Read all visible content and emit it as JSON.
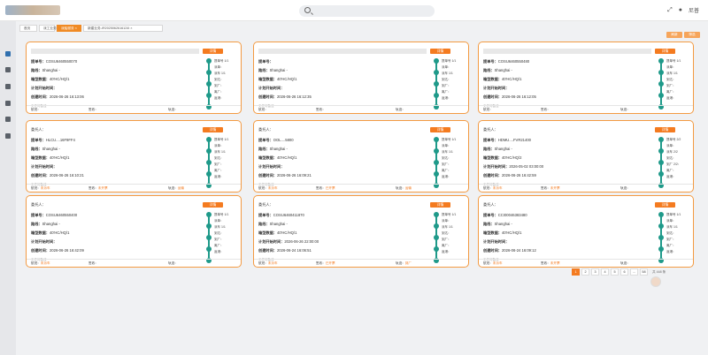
{
  "app": {
    "title": "",
    "user": "尼普"
  },
  "search": {
    "placeholder": ""
  },
  "tabs": [
    {
      "label": "首页",
      "active": false
    },
    {
      "label": "派工业务",
      "active": false
    },
    {
      "label": "派船服务 ×",
      "active": true
    },
    {
      "label": "新建业务-IR2025062616124I ×",
      "active": false
    }
  ],
  "toolbar": {
    "refresh": "刷新",
    "filter": "筛选"
  },
  "cards": [
    {
      "id": "c1",
      "top_text": "",
      "fields": [
        {
          "label": "提单号：",
          "value": "COSU6460550070"
        },
        {
          "label": "路线：",
          "value": "Shanghai -"
        },
        {
          "label": "箱型数据：",
          "value": "40'HC/HQ/1"
        },
        {
          "label": "计划开始时间：",
          "value": ""
        },
        {
          "label": "创建时间：",
          "value": "2026-06-26 16:13:06"
        }
      ],
      "note": "无任何备注",
      "footer": {
        "ship": "航班：",
        "ship_status": "",
        "sign": "签收：",
        "sign_status": "",
        "tracking": "轨迹：",
        "tracking_status": ""
      },
      "timeline": [
        "提单号 1/1",
        "派单：",
        "派车 1/1",
        "到达：",
        "到厂：",
        "离厂：",
        "返港："
      ]
    },
    {
      "id": "c2",
      "top_text": "",
      "fields": [
        {
          "label": "提单号：",
          "value": ""
        },
        {
          "label": "路线：",
          "value": "Shanghai -"
        },
        {
          "label": "箱型数据：",
          "value": "40'HC/HQ/1"
        },
        {
          "label": "计划开始时间：",
          "value": ""
        },
        {
          "label": "创建时间：",
          "value": "2026-06-26 16:12:35"
        }
      ],
      "note": "无任何备注",
      "footer": {
        "ship": "航班：",
        "ship_status": "",
        "sign": "签收：",
        "sign_status": "",
        "tracking": "轨迹：",
        "tracking_status": ""
      },
      "timeline": [
        "提单号 1/1",
        "派单：",
        "派车 1/1",
        "到达：",
        "到厂：",
        "离厂：",
        "返港："
      ]
    },
    {
      "id": "c3",
      "top_text": "",
      "fields": [
        {
          "label": "提单号：",
          "value": "COSU6460550480"
        },
        {
          "label": "路线：",
          "value": "Shanghai -"
        },
        {
          "label": "箱型数据：",
          "value": "40'HC/HQ/1"
        },
        {
          "label": "计划开始时间：",
          "value": ""
        },
        {
          "label": "创建时间：",
          "value": "2026-06-26 16:12:05"
        }
      ],
      "note": "无任何备注",
      "footer": {
        "ship": "航班：",
        "ship_status": "",
        "sign": "签收：",
        "sign_status": "",
        "tracking": "轨迹：",
        "tracking_status": ""
      },
      "timeline": [
        "提单号 1/1",
        "派单：",
        "派车 1/1",
        "到达：",
        "到厂：",
        "离厂：",
        "返港："
      ]
    },
    {
      "id": "c4",
      "top_text": "委托人：",
      "fields": [
        {
          "label": "提单号：",
          "value": "HLCU....16F9FF4"
        },
        {
          "label": "路线：",
          "value": "Shanghai -"
        },
        {
          "label": "箱型数据：",
          "value": "40'HC/HQ/1"
        },
        {
          "label": "计划开始时间：",
          "value": ""
        },
        {
          "label": "创建时间：",
          "value": "2026-06-26 16:10:21"
        }
      ],
      "note": "无任何备注",
      "footer": {
        "ship": "航班：",
        "ship_status": "未派车",
        "sign": "签收：",
        "sign_status": "未开票",
        "tracking": "轨迹：",
        "tracking_status": "运输"
      },
      "timeline": [
        "提单号 1/1",
        "派单：",
        "派车 1/1",
        "到达：",
        "到厂：",
        "离厂：",
        "返港："
      ]
    },
    {
      "id": "c5",
      "top_text": "委托人：",
      "fields": [
        {
          "label": "提单号：",
          "value": "OOL....5800"
        },
        {
          "label": "路线：",
          "value": "Shanghai -"
        },
        {
          "label": "箱型数据：",
          "value": "40'HC/HQ/1"
        },
        {
          "label": "计划开始时间：",
          "value": ""
        },
        {
          "label": "创建时间：",
          "value": "2026-06-26 16:09:21"
        }
      ],
      "note": "无任何备注",
      "footer": {
        "ship": "航班：",
        "ship_status": "未派车",
        "sign": "签收：",
        "sign_status": "已开票",
        "tracking": "轨迹：",
        "tracking_status": "运输"
      },
      "timeline": [
        "提单号 1/1",
        "派单：",
        "派车 1/1",
        "到达：",
        "到厂：",
        "离厂：",
        "返港："
      ]
    },
    {
      "id": "c6",
      "top_text": "委托人：",
      "fields": [
        {
          "label": "提单号：",
          "value": "HDMU....FVR21400"
        },
        {
          "label": "路线：",
          "value": "Shanghai -"
        },
        {
          "label": "箱型数据：",
          "value": "40'HC/HQ/2"
        },
        {
          "label": "计划开始时间：",
          "value": "2026-05-02 03:00:00"
        },
        {
          "label": "创建时间：",
          "value": "2026-06-26 16:42:59"
        }
      ],
      "note": "无任何备注",
      "footer": {
        "ship": "航班：",
        "ship_status": "未派车",
        "sign": "签收：",
        "sign_status": "未开票",
        "tracking": "轨迹：",
        "tracking_status": ""
      },
      "timeline": [
        "提单号 2/2",
        "派单：",
        "派车 2/2",
        "到达：",
        "到厂 2/2：",
        "离厂：",
        "返港："
      ]
    },
    {
      "id": "c7",
      "top_text": "委托人：",
      "fields": [
        {
          "label": "提单号：",
          "value": "COSU6460550400"
        },
        {
          "label": "路线：",
          "value": "Shanghai -"
        },
        {
          "label": "箱型数据：",
          "value": "40'HC/HQ/1"
        },
        {
          "label": "计划开始时间：",
          "value": ""
        },
        {
          "label": "创建时间：",
          "value": "2026-06-26 16:42:09"
        }
      ],
      "note": "无任何备注",
      "footer": {
        "ship": "航班：",
        "ship_status": "未派车",
        "sign": "签收：",
        "sign_status": "",
        "tracking": "轨迹：",
        "tracking_status": ""
      },
      "timeline": [
        "提单号 1/1",
        "派单：",
        "派车 1/1",
        "到达：",
        "到厂：",
        "离厂：",
        "返港："
      ]
    },
    {
      "id": "c8",
      "top_text": "委托人：",
      "fields": [
        {
          "label": "提单号：",
          "value": "COSU6460411870"
        },
        {
          "label": "路线：",
          "value": "Shanghai -"
        },
        {
          "label": "箱型数据：",
          "value": "40'HC/HQ/1"
        },
        {
          "label": "计划开始时间：",
          "value": "2026-06-26 22:00:00"
        },
        {
          "label": "创建时间：",
          "value": "2026-06-24 16:06:51"
        }
      ],
      "note": "无任何备注",
      "footer": {
        "ship": "航班：",
        "ship_status": "未派车",
        "sign": "签收：",
        "sign_status": "已开票",
        "tracking": "轨迹：",
        "tracking_status": "到厂"
      },
      "timeline": [
        "提单号 1/1",
        "派单：",
        "派车 1/1",
        "到达：",
        "到厂：",
        "离厂：",
        "返港："
      ]
    },
    {
      "id": "c9",
      "top_text": "委托人：",
      "fields": [
        {
          "label": "提单号：",
          "value": "CCI00046383480"
        },
        {
          "label": "路线：",
          "value": "Shanghai -"
        },
        {
          "label": "箱型数据：",
          "value": "40'HC/HQ/1"
        },
        {
          "label": "计划开始时间：",
          "value": ""
        },
        {
          "label": "创建时间：",
          "value": "2026-06-24 16:09:12"
        }
      ],
      "note": "无任何备注",
      "footer": {
        "ship": "航班：",
        "ship_status": "未派车",
        "sign": "签收：",
        "sign_status": "未开票",
        "tracking": "轨迹：",
        "tracking_status": ""
      },
      "timeline": [
        "提单号 1/1",
        "派单：",
        "派车 1/1",
        "到达：",
        "到厂：",
        "离厂：",
        "返港："
      ]
    }
  ],
  "pagination": {
    "pages": [
      "1",
      "2",
      "3",
      "4",
      "5",
      "6",
      "...",
      "58"
    ],
    "active": "1",
    "total": "共 448 条"
  }
}
